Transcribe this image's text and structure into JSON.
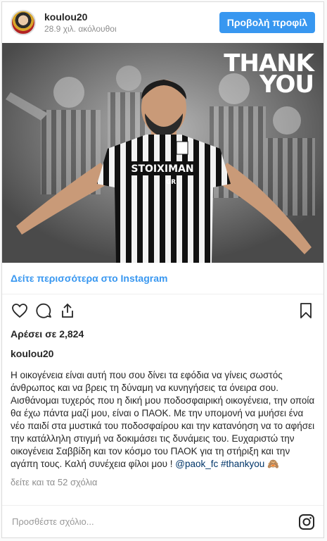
{
  "header": {
    "username": "koulou20",
    "followers": "28.9 χιλ. ακόλουθοι",
    "view_profile_label": "Προβολή προφίλ"
  },
  "photo": {
    "overlay_line1": "THANK",
    "overlay_line2": "YOU",
    "shirt_text": "STOIXIMAN",
    "shirt_sub": "GR"
  },
  "see_more": "Δείτε περισσότερα στο Instagram",
  "likes": "Αρέσει σε 2,824",
  "post": {
    "username": "koulou20",
    "caption_text": "Η οικογένεια είναι αυτή που σου δίνει τα εφόδια να γίνεις σωστός άνθρωπος και να βρεις τη δύναμη να κυνηγήσεις τα όνειρα σου. Αισθάνομαι τυχερός που η δική μου ποδοσφαιρική οικογένεια, την οποία θα έχω πάντα μαζί μου, είναι ο ΠΑΟΚ. Με την υπομονή να μυήσει ένα νέο παιδί στα μυστικά του ποδοσφαίρου και την κατανόηση να το αφήσει την κατάλληλη στιγμή να δοκιμάσει τις δυνάμεις του. Ευχαριστώ την οικογένεια Σαββίδη και τον κόσμο του ΠΑΟΚ για τη στήριξη και την αγάπη τους. Καλή συνέχεια φίλοι μου ! ",
    "mention": "@paok_fc",
    "hashtag": "#thankyou",
    "emoji": "🙈"
  },
  "comments_link": "δείτε και τα 52 σχόλια",
  "comment_placeholder": "Προσθέστε σχόλιο...",
  "colors": {
    "accent": "#3897f0",
    "link": "#003569"
  },
  "icons": [
    "heart-icon",
    "comment-icon",
    "share-icon",
    "bookmark-icon",
    "instagram-icon"
  ]
}
